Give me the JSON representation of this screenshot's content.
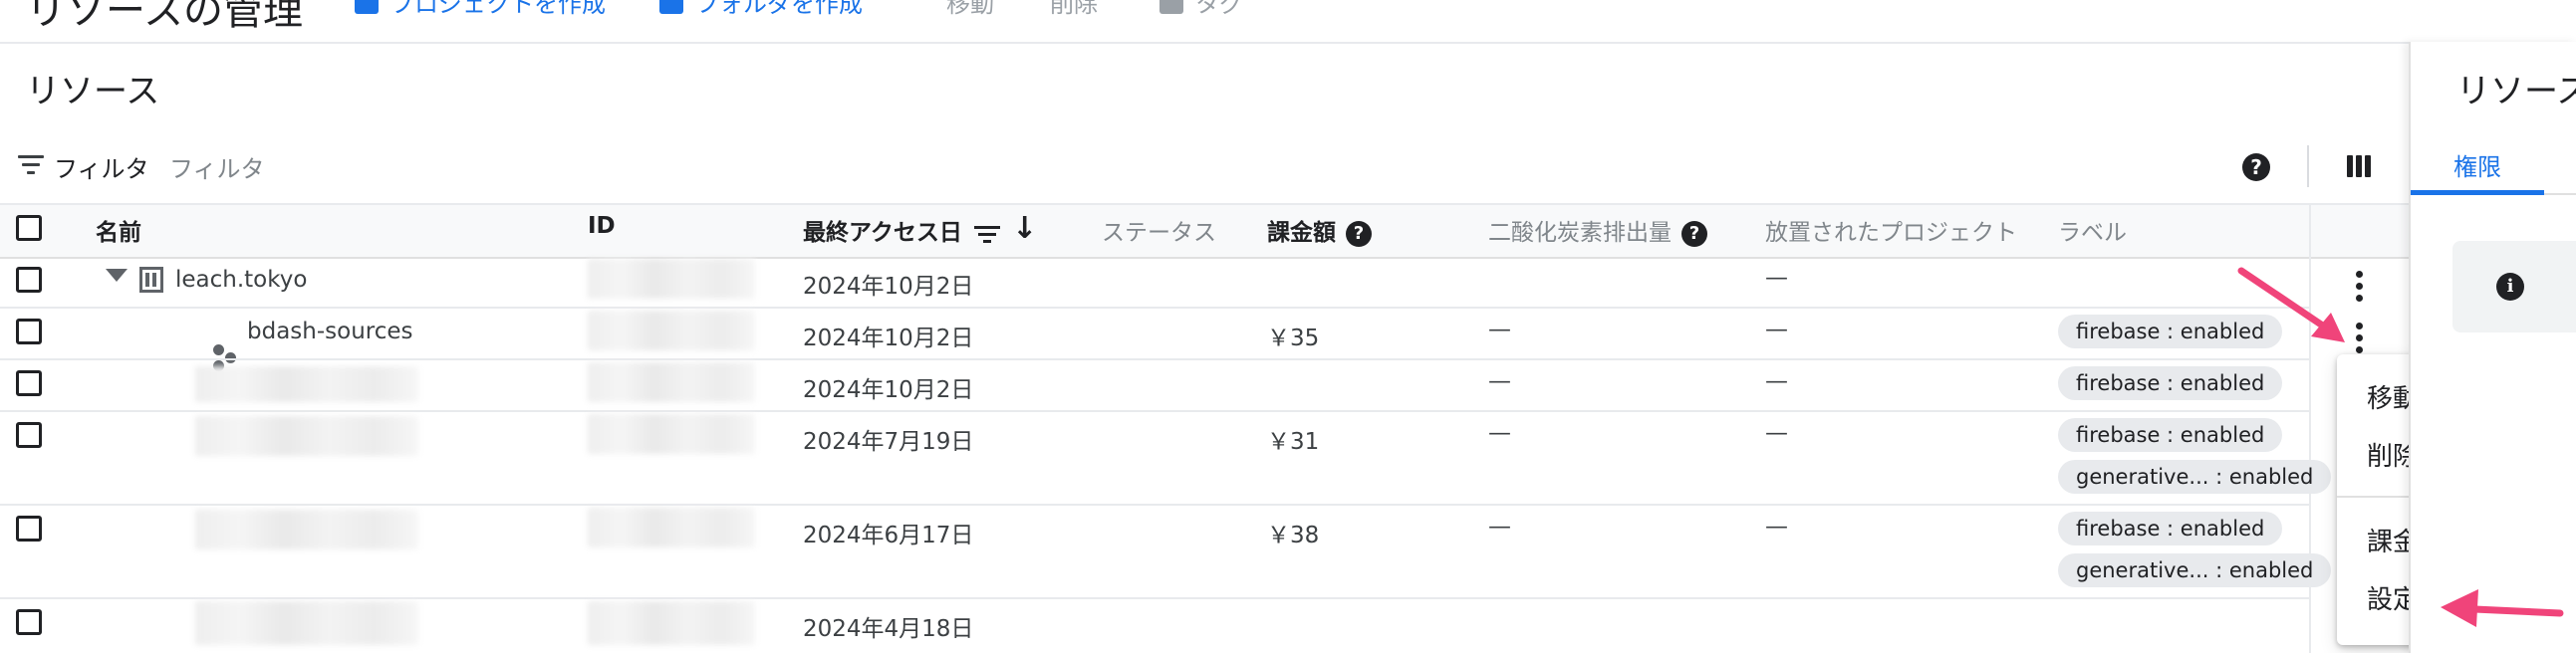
{
  "topbar": {
    "title": "リソースの管理",
    "create_project": "プロジェクトを作成",
    "create_folder": "フォルダを作成",
    "move": "移動",
    "delete": "削除",
    "tag": "タグ"
  },
  "resources": {
    "title": "リソース",
    "filter_label": "フィルタ",
    "filter_placeholder": "フィルタ"
  },
  "table": {
    "headers": {
      "name": "名前",
      "id": "ID",
      "last_access": "最終アクセス日",
      "status": "ステータス",
      "billing": "課金額",
      "co2": "二酸化炭素排出量",
      "abandoned": "放置されたプロジェクト",
      "labels": "ラベル"
    },
    "rows": [
      {
        "name": "leach.tokyo",
        "date": "2024年10月2日",
        "billing": "",
        "co2": "",
        "abandoned": "—",
        "labels": []
      },
      {
        "name": "bdash-sources",
        "date": "2024年10月2日",
        "billing": "￥35",
        "co2": "—",
        "abandoned": "—",
        "labels": [
          "firebase : enabled"
        ]
      },
      {
        "name": "",
        "date": "2024年10月2日",
        "billing": "",
        "co2": "—",
        "abandoned": "—",
        "labels": [
          "firebase : enabled"
        ]
      },
      {
        "name": "",
        "date": "2024年7月19日",
        "billing": "￥31",
        "co2": "—",
        "abandoned": "—",
        "labels": [
          "firebase : enabled",
          "generative... : enabled"
        ]
      },
      {
        "name": "",
        "date": "2024年6月17日",
        "billing": "￥38",
        "co2": "—",
        "abandoned": "—",
        "labels": [
          "firebase : enabled",
          "generative... : enabled"
        ]
      },
      {
        "name": "",
        "date": "2024年4月18日",
        "billing": "",
        "co2": "",
        "abandoned": "",
        "labels": []
      }
    ]
  },
  "context_menu": {
    "move": "移動",
    "delete": "削除",
    "billing": "課金",
    "settings": "設定"
  },
  "right_panel": {
    "title": "リソース",
    "tab_permissions": "権限"
  },
  "colors": {
    "accent": "#1a73e8",
    "annotation_arrow": "#f0447a",
    "chip_bg": "#e8eaed"
  }
}
